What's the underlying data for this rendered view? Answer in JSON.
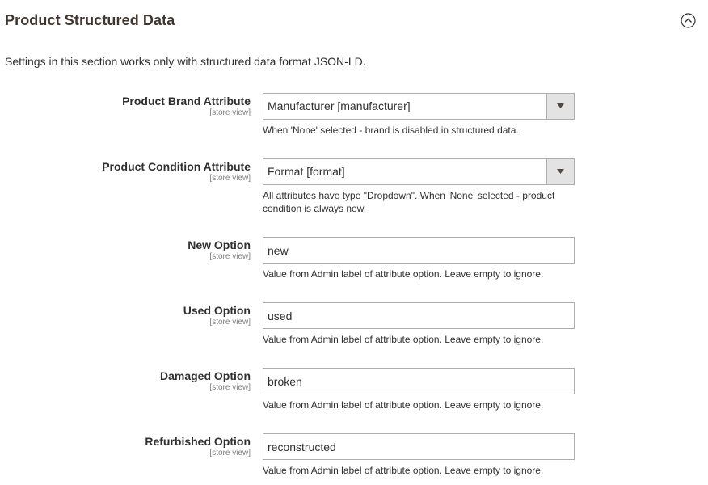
{
  "section": {
    "title": "Product Structured Data",
    "note": "Settings in this section works only with structured data format JSON-LD."
  },
  "fields": {
    "brand": {
      "label": "Product Brand Attribute",
      "scope": "[store view]",
      "value": "Manufacturer [manufacturer]",
      "note": "When 'None' selected - brand is disabled in structured data."
    },
    "condition": {
      "label": "Product Condition Attribute",
      "scope": "[store view]",
      "value": "Format [format]",
      "note_line1": "All attributes have type \"Dropdown\". When 'None' selected - product",
      "note_line2": "condition is always new."
    },
    "new_option": {
      "label": "New Option",
      "scope": "[store view]",
      "value": "new",
      "note": "Value from Admin label of attribute option. Leave empty to ignore."
    },
    "used_option": {
      "label": "Used Option",
      "scope": "[store view]",
      "value": "used",
      "note": "Value from Admin label of attribute option. Leave empty to ignore."
    },
    "damaged_option": {
      "label": "Damaged Option",
      "scope": "[store view]",
      "value": "broken",
      "note": "Value from Admin label of attribute option. Leave empty to ignore."
    },
    "refurbished_option": {
      "label": "Refurbished Option",
      "scope": "[store view]",
      "value": "reconstructed",
      "note": "Value from Admin label of attribute option. Leave empty to ignore."
    }
  },
  "icons": {
    "collapse": "chevron-up-circle-icon",
    "dropdown": "triangle-down-icon"
  },
  "colors": {
    "title": "#41362f",
    "text": "#303030",
    "scope": "#808080",
    "border": "#adadad",
    "select_button": "#e3e3e3"
  }
}
